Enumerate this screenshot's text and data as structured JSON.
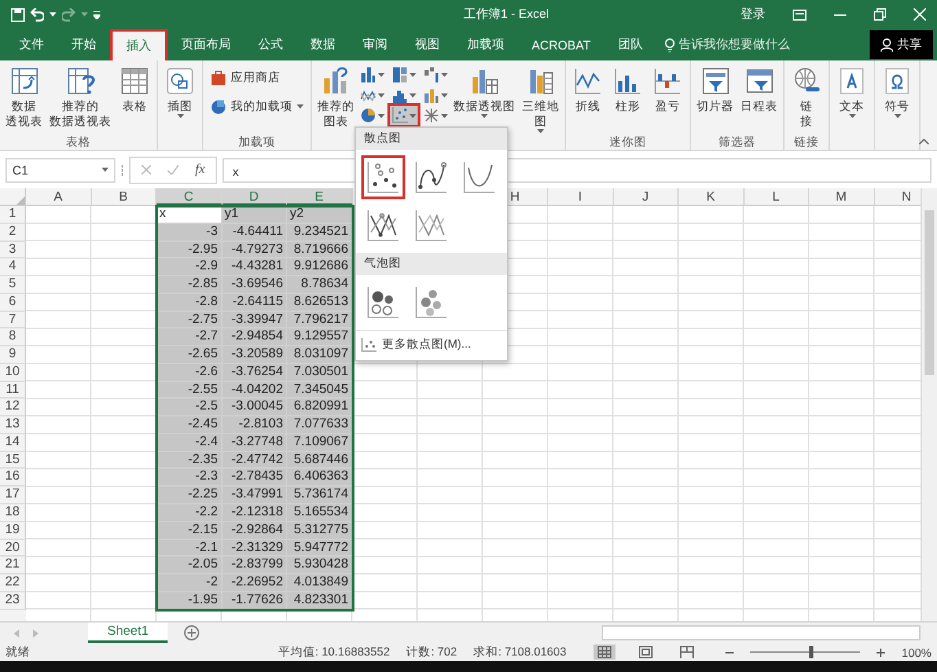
{
  "window": {
    "title": "工作簿1 - Excel",
    "sign_in": "登录",
    "redo_disabled": true
  },
  "tabs": [
    {
      "label": "文件",
      "selected": false
    },
    {
      "label": "开始",
      "selected": false
    },
    {
      "label": "插入",
      "selected": true
    },
    {
      "label": "页面布局",
      "selected": false
    },
    {
      "label": "公式",
      "selected": false
    },
    {
      "label": "数据",
      "selected": false
    },
    {
      "label": "审阅",
      "selected": false
    },
    {
      "label": "视图",
      "selected": false
    },
    {
      "label": "加载项",
      "selected": false
    },
    {
      "label": "ACROBAT",
      "selected": false
    },
    {
      "label": "团队",
      "selected": false
    }
  ],
  "tell_me": "告诉我你想要做什么",
  "share": "共享",
  "ribbon": {
    "groups": [
      {
        "label": "表格",
        "buttons": [
          {
            "kind": "large",
            "lines": [
              "数据",
              "透视表"
            ]
          },
          {
            "kind": "large",
            "lines": [
              "推荐的",
              "数据透视表"
            ]
          },
          {
            "kind": "large",
            "lines": [
              "表格"
            ]
          }
        ]
      },
      {
        "buttons": [
          {
            "kind": "large",
            "lines": [
              "插图"
            ],
            "dropdown": true
          }
        ]
      },
      {
        "label": "加载项",
        "buttons": [
          {
            "kind": "small",
            "label": "应用商店"
          },
          {
            "kind": "small",
            "label": "我的加载项",
            "dropdown": true
          }
        ]
      },
      {
        "buttons": [
          {
            "kind": "large",
            "lines": [
              "推荐的",
              "图表"
            ]
          },
          {
            "kind": "iconset",
            "icons": [
              {
                "pressed": false
              },
              {
                "pressed": false
              },
              {
                "pressed": false
              },
              {
                "pressed": false
              },
              {
                "pressed": false
              },
              {
                "pressed": false
              },
              {
                "pressed": false
              },
              {
                "pressed": true
              },
              {
                "pressed": false
              }
            ]
          },
          {
            "kind": "large",
            "lines": [
              "数据透视图"
            ],
            "dropdown": true
          },
          {
            "kind": "large",
            "lines": [
              "三维地",
              "图"
            ],
            "dropdown": true
          }
        ]
      },
      {
        "label": "迷你图",
        "buttons": [
          {
            "kind": "large",
            "lines": [
              "折线"
            ]
          },
          {
            "kind": "large",
            "lines": [
              "柱形"
            ]
          },
          {
            "kind": "large",
            "lines": [
              "盈亏"
            ]
          }
        ]
      },
      {
        "label": "筛选器",
        "buttons": [
          {
            "kind": "large",
            "lines": [
              "切片器"
            ]
          },
          {
            "kind": "large",
            "lines": [
              "日程表"
            ]
          }
        ]
      },
      {
        "label": "链接",
        "buttons": [
          {
            "kind": "large",
            "lines": [
              "链",
              "接"
            ]
          }
        ]
      },
      {
        "buttons": [
          {
            "kind": "large",
            "lines": [
              "文本"
            ],
            "dropdown": true
          }
        ]
      },
      {
        "buttons": [
          {
            "kind": "large",
            "lines": [
              "符号"
            ],
            "dropdown": true
          }
        ]
      }
    ]
  },
  "formula_bar": {
    "name_box": "C1",
    "function_button": "fx",
    "value": "x"
  },
  "sheet": {
    "columns_left": [
      {
        "label": "A",
        "selected": false
      },
      {
        "label": "B",
        "selected": false
      },
      {
        "label": "C",
        "selected": true
      },
      {
        "label": "D",
        "selected": true
      },
      {
        "label": "E",
        "selected": true
      }
    ],
    "columns_right": [
      {
        "label": "H",
        "selected": false
      },
      {
        "label": "I",
        "selected": false
      },
      {
        "label": "J",
        "selected": false
      },
      {
        "label": "K",
        "selected": false
      },
      {
        "label": "L",
        "selected": false
      },
      {
        "label": "M",
        "selected": false
      },
      {
        "label": "N",
        "selected": false
      }
    ],
    "rows": [
      {
        "number": "1",
        "kind": "header",
        "cells": [
          "x",
          "y1",
          "y2"
        ]
      },
      {
        "number": "2",
        "kind": "data",
        "cells": [
          "-3",
          "-4.64411",
          "9.234521"
        ]
      },
      {
        "number": "3",
        "kind": "data",
        "cells": [
          "-2.95",
          "-4.79273",
          "8.719666"
        ]
      },
      {
        "number": "4",
        "kind": "data",
        "cells": [
          "-2.9",
          "-4.43281",
          "9.912686"
        ]
      },
      {
        "number": "5",
        "kind": "data",
        "cells": [
          "-2.85",
          "-3.69546",
          "8.78634"
        ]
      },
      {
        "number": "6",
        "kind": "data",
        "cells": [
          "-2.8",
          "-2.64115",
          "8.626513"
        ]
      },
      {
        "number": "7",
        "kind": "data",
        "cells": [
          "-2.75",
          "-3.39947",
          "7.796217"
        ]
      },
      {
        "number": "8",
        "kind": "data",
        "cells": [
          "-2.7",
          "-2.94854",
          "9.129557"
        ]
      },
      {
        "number": "9",
        "kind": "data",
        "cells": [
          "-2.65",
          "-3.20589",
          "8.031097"
        ]
      },
      {
        "number": "10",
        "kind": "data",
        "cells": [
          "-2.6",
          "-3.76254",
          "7.030501"
        ]
      },
      {
        "number": "11",
        "kind": "data",
        "cells": [
          "-2.55",
          "-4.04202",
          "7.345045"
        ]
      },
      {
        "number": "12",
        "kind": "data",
        "cells": [
          "-2.5",
          "-3.00045",
          "6.820991"
        ]
      },
      {
        "number": "13",
        "kind": "data",
        "cells": [
          "-2.45",
          "-2.8103",
          "7.077633"
        ]
      },
      {
        "number": "14",
        "kind": "data",
        "cells": [
          "-2.4",
          "-3.27748",
          "7.109067"
        ]
      },
      {
        "number": "15",
        "kind": "data",
        "cells": [
          "-2.35",
          "-2.47742",
          "5.687446"
        ]
      },
      {
        "number": "16",
        "kind": "data",
        "cells": [
          "-2.3",
          "-2.78435",
          "6.406363"
        ]
      },
      {
        "number": "17",
        "kind": "data",
        "cells": [
          "-2.25",
          "-3.47991",
          "5.736174"
        ]
      },
      {
        "number": "18",
        "kind": "data",
        "cells": [
          "-2.2",
          "-2.12318",
          "5.165534"
        ]
      },
      {
        "number": "19",
        "kind": "data",
        "cells": [
          "-2.15",
          "-2.92864",
          "5.312775"
        ]
      },
      {
        "number": "20",
        "kind": "data",
        "cells": [
          "-2.1",
          "-2.31329",
          "5.947772"
        ]
      },
      {
        "number": "21",
        "kind": "data",
        "cells": [
          "-2.05",
          "-2.83799",
          "5.930428"
        ]
      },
      {
        "number": "22",
        "kind": "data",
        "cells": [
          "-2",
          "-2.26952",
          "4.013849"
        ]
      },
      {
        "number": "23",
        "kind": "data",
        "cells": [
          "-1.95",
          "-1.77626",
          "4.823301"
        ]
      }
    ]
  },
  "menu": {
    "sections": [
      {
        "title": "散点图",
        "items": [
          {
            "selected": true
          },
          {
            "selected": false
          },
          {
            "selected": false
          },
          {
            "selected": false
          },
          {
            "selected": false
          }
        ]
      },
      {
        "title": "气泡图",
        "items": [
          {
            "selected": false
          },
          {
            "selected": false
          }
        ]
      }
    ],
    "footer": "更多散点图(M)..."
  },
  "sheet_tabs": [
    {
      "label": "Sheet1",
      "selected": true
    }
  ],
  "status_bar": {
    "state": "就绪",
    "average": "平均值: 10.16883552",
    "count": "计数: 702",
    "sum": "求和: 7108.01603",
    "views": [
      {
        "selected": true
      },
      {
        "selected": false
      },
      {
        "selected": false
      }
    ],
    "zoom": {
      "level": 0.55,
      "reading": "100%"
    }
  }
}
